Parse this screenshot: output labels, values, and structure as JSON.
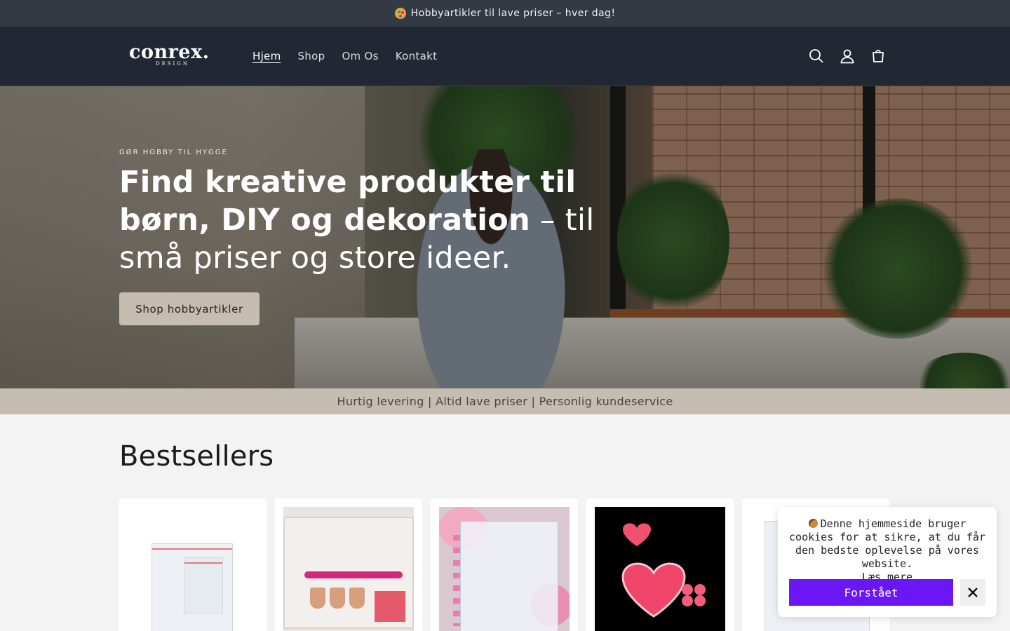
{
  "announcement": {
    "text": "Hobbyartikler til lave priser – hver dag!",
    "icon": "palette-icon"
  },
  "header": {
    "logo": {
      "word": "conrex.",
      "sub": "DESIGN"
    },
    "nav": [
      {
        "label": "Hjem",
        "active": true
      },
      {
        "label": "Shop",
        "active": false
      },
      {
        "label": "Om Os",
        "active": false
      },
      {
        "label": "Kontakt",
        "active": false
      }
    ],
    "icons": [
      "search-icon",
      "account-icon",
      "cart-icon"
    ]
  },
  "hero": {
    "eyebrow": "GØR HOBBY TIL HYGGE",
    "headline_bold": "Find kreative produkter til børn, DIY og dekoration",
    "headline_rest": " – til små priser og store ideer.",
    "cta": "Shop hobbyartikler"
  },
  "usp": {
    "text": "Hurtig levering | Altid lave priser | Personlig kundeservice"
  },
  "bestsellers": {
    "title": "Bestsellers",
    "products": [
      {
        "image": "clear resealable plastic bags"
      },
      {
        "image": "pink nail art tool kit"
      },
      {
        "image": "diamond painting storage binder"
      },
      {
        "image": "red heart wax melts"
      },
      {
        "image": "clear plastic bags"
      }
    ]
  },
  "cookie_banner": {
    "text": "Denne hjemmeside bruger cookies for at sikre, at du får den bedste oplevelse på vores website.",
    "link": "Læs mere",
    "accept": "Forstået",
    "accent": "#6a16f5"
  },
  "colors": {
    "announcement_bg": "#333a44",
    "header_bg": "#222833",
    "usp_bg": "#c5bcb2",
    "cta_bg": "#c7bcb0"
  }
}
